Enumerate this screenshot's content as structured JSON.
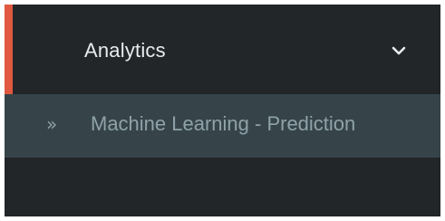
{
  "colors": {
    "background": "#222629",
    "accent": "#e0583f",
    "active_row": "#36444a",
    "label_active": "#e8ecee",
    "label_muted": "#8fa2a8"
  },
  "menu": {
    "section": {
      "label": "Analytics",
      "expanded_icon": "chevron-down-icon"
    },
    "items": [
      {
        "label": "Machine Learning - Prediction",
        "icon": "double-chevron-right-icon",
        "icon_glyph": "»"
      }
    ]
  }
}
